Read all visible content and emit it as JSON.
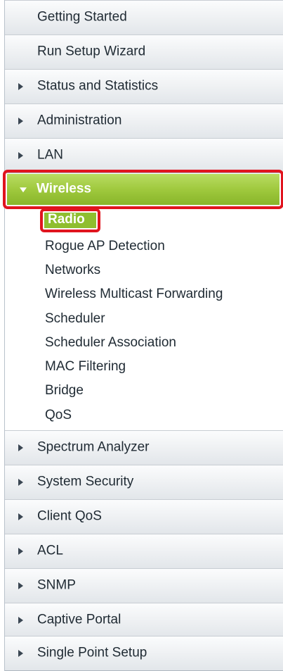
{
  "nav": {
    "top_items": [
      {
        "label": "Getting Started"
      },
      {
        "label": "Run Setup Wizard"
      },
      {
        "label": "Status and Statistics"
      },
      {
        "label": "Administration"
      },
      {
        "label": "LAN"
      }
    ],
    "wireless": {
      "label": "Wireless",
      "expanded": true,
      "sub_items": [
        {
          "label": "Radio",
          "selected": true
        },
        {
          "label": "Rogue AP Detection"
        },
        {
          "label": "Networks"
        },
        {
          "label": "Wireless Multicast Forwarding"
        },
        {
          "label": "Scheduler"
        },
        {
          "label": "Scheduler Association"
        },
        {
          "label": "MAC Filtering"
        },
        {
          "label": "Bridge"
        },
        {
          "label": "QoS"
        }
      ]
    },
    "bottom_items": [
      {
        "label": "Spectrum Analyzer"
      },
      {
        "label": "System Security"
      },
      {
        "label": "Client QoS"
      },
      {
        "label": "ACL"
      },
      {
        "label": "SNMP"
      },
      {
        "label": "Captive Portal"
      },
      {
        "label": "Single Point Setup"
      }
    ]
  },
  "colors": {
    "active_green": "#9dc73b",
    "highlight_red": "#e0141e",
    "item_gradient_top": "#fbfcfd",
    "item_gradient_bottom": "#e2e6ea"
  },
  "icons": {
    "collapsed_arrow": "triangle-right-icon",
    "expanded_arrow": "triangle-down-icon"
  }
}
